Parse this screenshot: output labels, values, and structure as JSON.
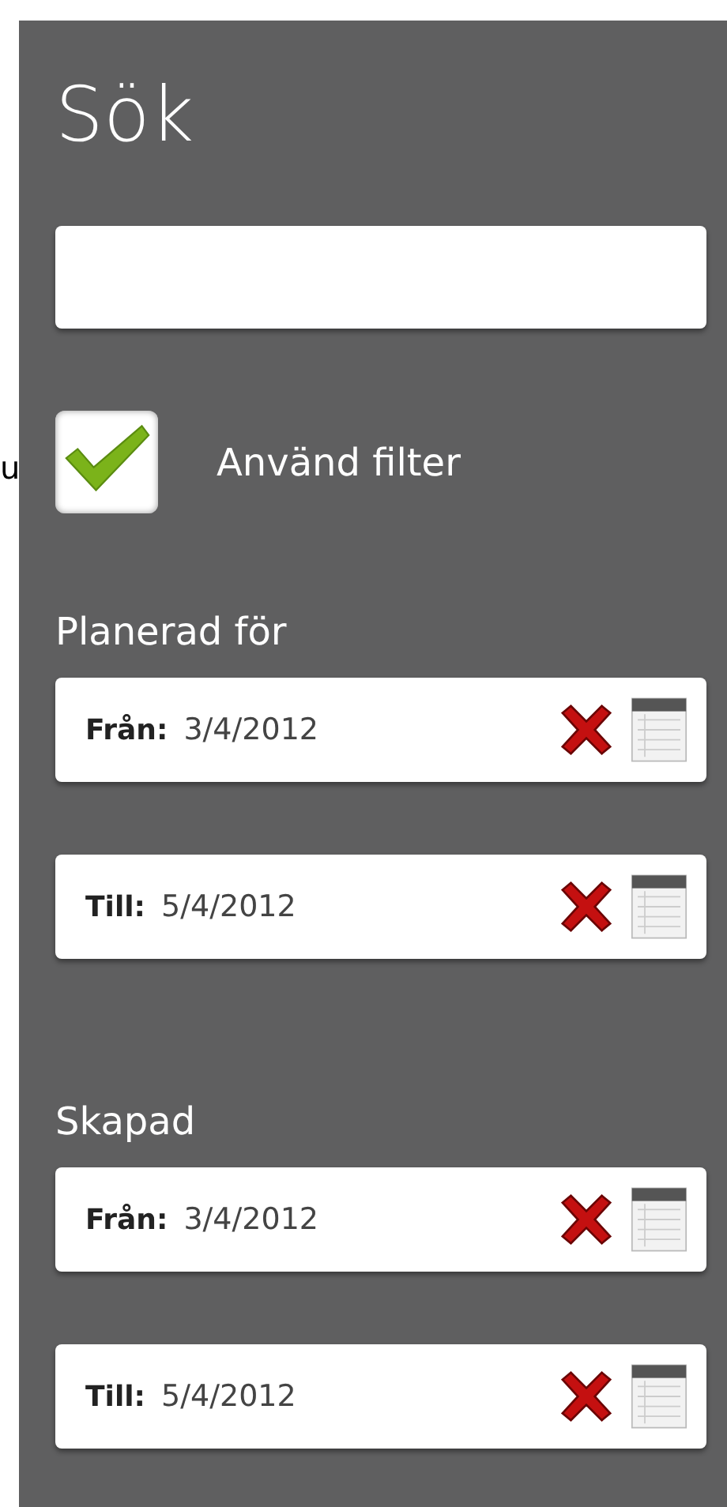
{
  "edge_fragment": "u",
  "title": "Sök",
  "filter": {
    "label": "Använd filter",
    "checked": true
  },
  "sections": [
    {
      "heading": "Planerad för",
      "fields": [
        {
          "label": "Från:",
          "value": "3/4/2012"
        },
        {
          "label": "Till:",
          "value": "5/4/2012"
        }
      ]
    },
    {
      "heading": "Skapad",
      "fields": [
        {
          "label": "Från:",
          "value": "3/4/2012"
        },
        {
          "label": "Till:",
          "value": "5/4/2012"
        }
      ]
    }
  ]
}
